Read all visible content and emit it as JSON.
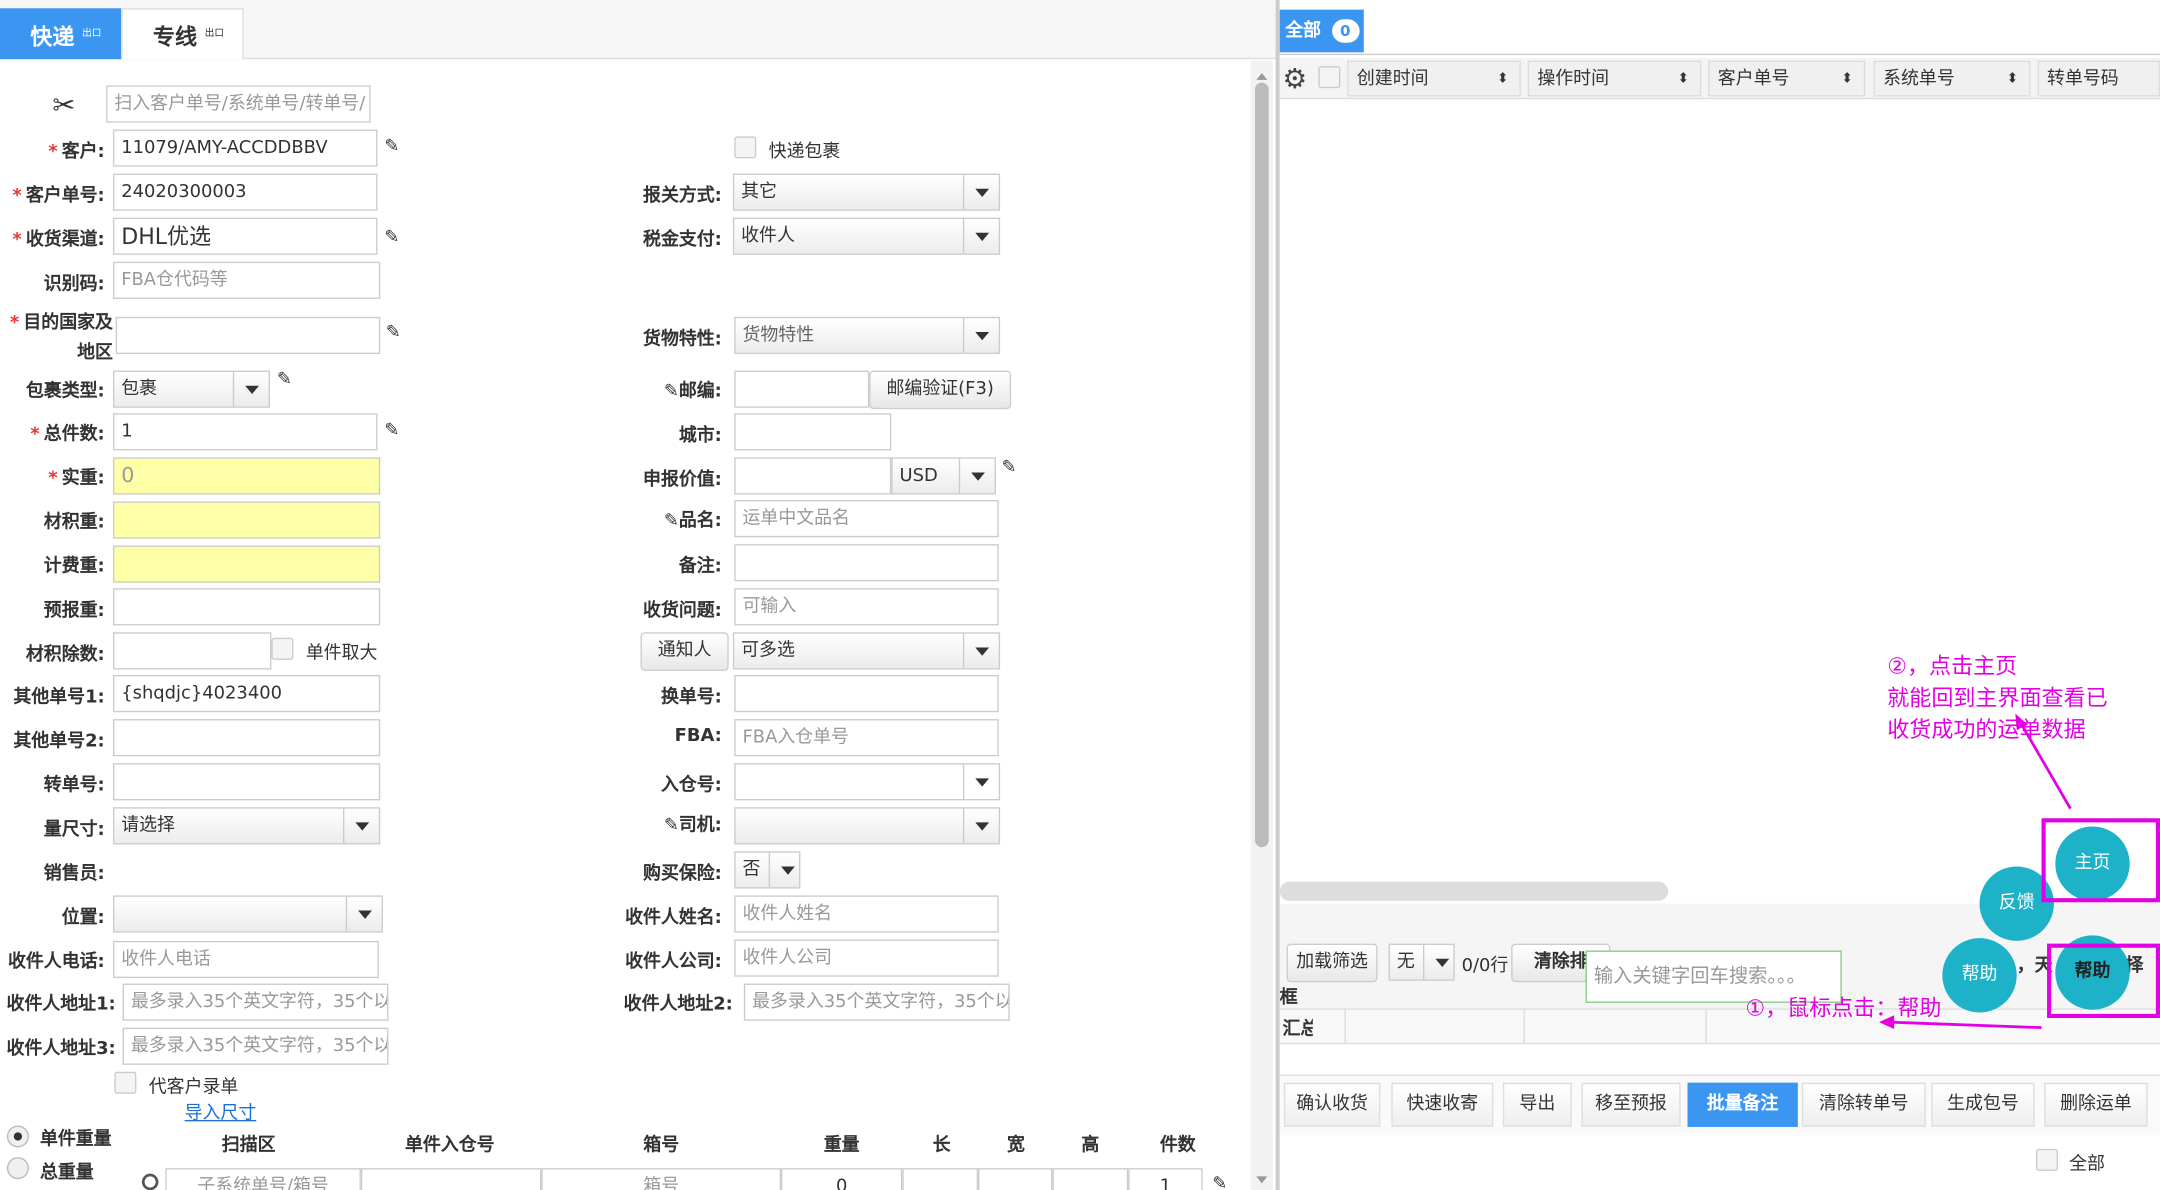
{
  "tabs": [
    {
      "label": "快递",
      "badge": "出口"
    },
    {
      "label": "专线",
      "badge": "出口"
    }
  ],
  "scan": {
    "placeholder": "扫入客户单号/系统单号/转单号/"
  },
  "left": {
    "customer_label": "客户:",
    "customer_value": "11079/AMY-ACCDDBBV",
    "custno_label": "客户单号:",
    "custno_value": "24020300003",
    "channel_label": "收货渠道:",
    "channel_value": "DHL优选",
    "idcode_label": "识别码:",
    "idcode_placeholder": "FBA仓代码等",
    "dest_label1": "目的国家及",
    "dest_label2": "地区",
    "pkgtype_label": "包裹类型:",
    "pkgtype_value": "包裹",
    "pieces_label": "总件数:",
    "pieces_value": "1",
    "weight_label": "实重:",
    "weight_value": "0",
    "volweight_label": "材积重:",
    "chargeweight_label": "计费重:",
    "preweight_label": "预报重:",
    "divisor_label": "材积除数:",
    "single_max_label": "单件取大",
    "other1_label": "其他单号1:",
    "other1_value": "{shqdjc}4023400",
    "other2_label": "其他单号2:",
    "transfer_label": "转单号:",
    "measure_label": "量尺寸:",
    "measure_value": "请选择",
    "sales_label": "销售员:",
    "position_label": "位置:",
    "phone_label": "收件人电话:",
    "phone_placeholder": "收件人电话",
    "addr1_label": "收件人地址1:",
    "addr1_placeholder": "最多录入35个英文字符，35个以",
    "addr3_label": "收件人地址3:",
    "addr3_placeholder": "最多录入35个英文字符，35个以",
    "proxy_label": "代客户录单",
    "import_link": "导入尺寸",
    "single_weight": "单件重量",
    "total_weight": "总重量"
  },
  "mid": {
    "express_pkg": "快递包裹",
    "customs_label": "报关方式:",
    "customs_value": "其它",
    "tax_label": "税金支付:",
    "tax_value": "收件人",
    "goods_label": "货物特性:",
    "goods_value": "货物特性",
    "zip_label": "邮编:",
    "zip_btn": "邮编验证(F3)",
    "city_label": "城市:",
    "declare_label": "申报价值:",
    "currency": "USD",
    "name_label": "品名:",
    "name_placeholder": "运单中文品名",
    "remark_label": "备注:",
    "problem_label": "收货问题:",
    "problem_placeholder": "可输入",
    "notify_btn": "通知人",
    "notify_value": "可多选",
    "change_label": "换单号:",
    "fba_label": "FBA:",
    "fba_placeholder": "FBA入仓单号",
    "warehouse_label": "入仓号:",
    "driver_label": "司机:",
    "insurance_label": "购买保险:",
    "insurance_value": "否",
    "rname_label": "收件人姓名:",
    "rname_placeholder": "收件人姓名",
    "rcompany_label": "收件人公司:",
    "rcompany_placeholder": "收件人公司",
    "addr2_label": "收件人地址2:",
    "addr2_placeholder": "最多录入35个英文字符，35个以"
  },
  "table": {
    "headers": [
      "扫描区",
      "单件入仓号",
      "箱号",
      "重量",
      "长",
      "宽",
      "高",
      "件数"
    ],
    "row": {
      "sub_placeholder": "子系统单号/箱号",
      "box_placeholder": "箱号",
      "weight": "0",
      "pieces": "1"
    }
  },
  "right": {
    "tab_label": "全部",
    "tab_count": "0",
    "columns": [
      "创建时间",
      "操作时间",
      "客户单号",
      "系统单号",
      "转单号码"
    ],
    "load_filter": "加载筛选",
    "filter_value": "无",
    "rows_count": "0/0行",
    "clear_btn": "清除排",
    "search_placeholder": "输入关键字回车搜索。。。",
    "frame_label": "框",
    "summary_label": "汇总",
    "partial1": "，天",
    "partial2": "择",
    "actions": [
      "确认收货",
      "快速收寄",
      "导出",
      "移至预报",
      "批量备注",
      "清除转单号",
      "生成包号",
      "删除运单"
    ],
    "all_label": "全部"
  },
  "float": {
    "home": "主页",
    "feedback": "反馈",
    "help": "帮助"
  },
  "annotations": {
    "step2_line1": "②，点击主页",
    "step2_line2": "就能回到主界面查看已",
    "step2_line3": "收货成功的运单数据",
    "step1": "①，鼠标点击：帮助"
  },
  "colors": {
    "accent": "#3a96f0",
    "float": "#1eb2c9",
    "annotation": "#e400e4",
    "highlight": "#ffffa8"
  }
}
